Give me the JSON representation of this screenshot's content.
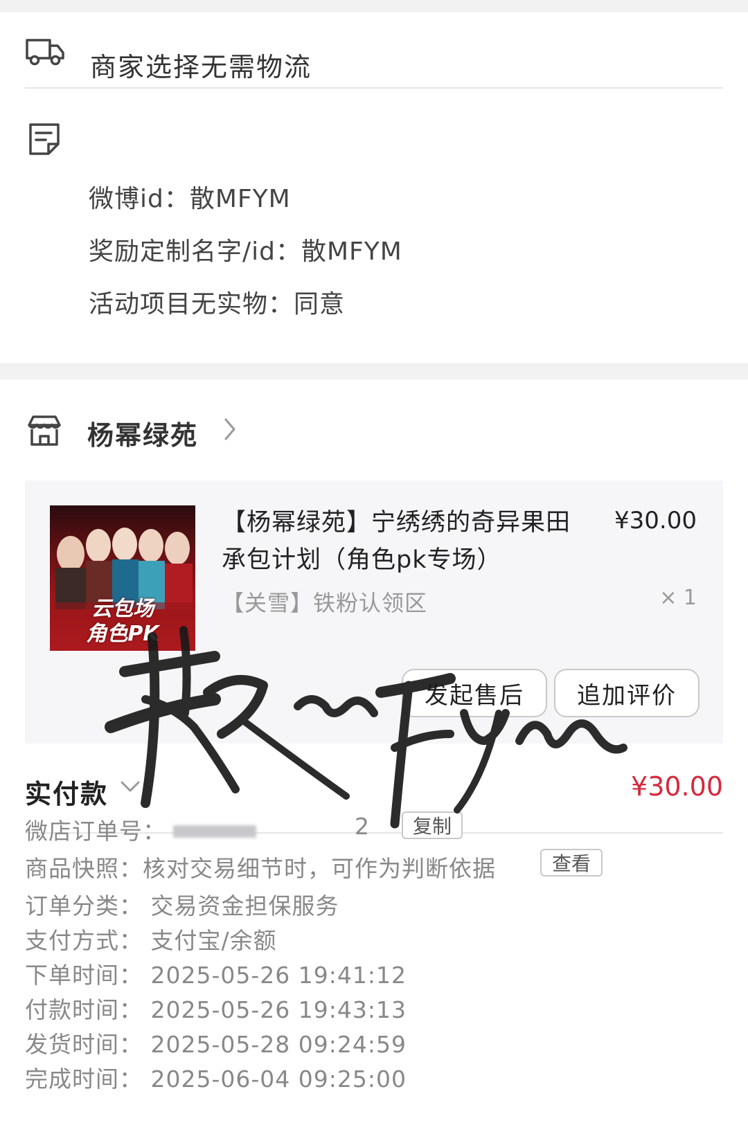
{
  "delivery": {
    "icon": "truck-icon",
    "text": "商家选择无需物流"
  },
  "notes": {
    "icon": "note-icon",
    "lines": [
      "微博id：散MFYM",
      "奖励定制名字/id：散MFYM",
      "活动项目无实物：同意"
    ]
  },
  "shop": {
    "icon": "store-icon",
    "name": "杨幂绿苑"
  },
  "product": {
    "image_text_1": "云包场",
    "image_text_2": "角色PK",
    "title": "【杨幂绿苑】宁绣绣的奇异果田承包计划（角色pk专场）",
    "price": "¥30.00",
    "sku": "【关雪】铁粉认领区",
    "quantity": "× 1",
    "actions": {
      "aftersale": "发起售后",
      "review": "追加评价"
    }
  },
  "payment": {
    "label": "实付款",
    "amount": "¥30.00"
  },
  "order_info": {
    "order_no_label": "微店订单号：",
    "order_no_tail": "2",
    "copy_label": "复制",
    "snapshot_label": "商品快照：核对交易细节时，可作为判断依据",
    "view_label": "查看",
    "category": "订单分类：  交易资金担保服务",
    "pay_method": "支付方式：  支付宝/余额",
    "order_time": "下单时间：  2025-05-26 19:41:12",
    "pay_time": "付款时间：  2025-05-26 19:43:13",
    "ship_time": "发货时间：  2025-05-28 09:24:59",
    "complete_time": "完成时间：  2025-06-04 09:25:00"
  },
  "colors": {
    "price_red": "#d6283c",
    "text": "#333333",
    "muted": "#888888",
    "bg": "#f2f2f2"
  }
}
